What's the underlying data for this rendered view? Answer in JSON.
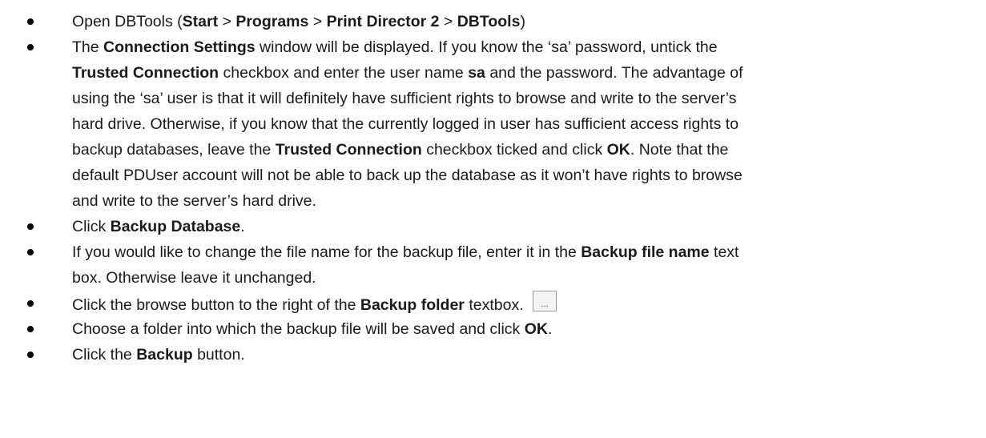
{
  "steps": [
    {
      "lines": [
        [
          {
            "t": "Open DBTools ("
          },
          {
            "t": "Start",
            "b": 1
          },
          {
            "t": " > "
          },
          {
            "t": "Programs",
            "b": 1
          },
          {
            "t": " > "
          },
          {
            "t": "Print Director 2",
            "b": 1
          },
          {
            "t": " > "
          },
          {
            "t": "DBTools",
            "b": 1
          },
          {
            "t": ")"
          }
        ]
      ]
    },
    {
      "lines": [
        [
          {
            "t": "The "
          },
          {
            "t": "Connection Settings",
            "b": 1
          },
          {
            "t": " window will be displayed. If you know the ‘sa’ password, untick the"
          }
        ],
        [
          {
            "t": "Trusted Connection",
            "b": 1
          },
          {
            "t": " checkbox and enter the user name "
          },
          {
            "t": "sa",
            "b": 1
          },
          {
            "t": " and the password. The advantage of"
          }
        ],
        [
          {
            "t": "using the ‘sa’ user is that it will definitely have sufficient rights to browse and write to the server’s"
          }
        ],
        [
          {
            "t": "hard drive. Otherwise, if you know that the currently logged in user has sufficient access rights to"
          }
        ],
        [
          {
            "t": "backup databases, leave the "
          },
          {
            "t": "Trusted Connection",
            "b": 1
          },
          {
            "t": " checkbox ticked and click "
          },
          {
            "t": "OK",
            "b": 1
          },
          {
            "t": ". Note that the"
          }
        ],
        [
          {
            "t": "default PDUser account will not be able to back up the database as it won’t have rights to browse"
          }
        ],
        [
          {
            "t": "and write to the server’s hard drive."
          }
        ]
      ]
    },
    {
      "lines": [
        [
          {
            "t": "Click "
          },
          {
            "t": "Backup Database",
            "b": 1
          },
          {
            "t": "."
          }
        ]
      ]
    },
    {
      "lines": [
        [
          {
            "t": "If you would like to change the file name for the backup file, enter it in the "
          },
          {
            "t": "Backup file name",
            "b": 1
          },
          {
            "t": " text"
          }
        ],
        [
          {
            "t": "box. Otherwise leave it unchanged."
          }
        ]
      ]
    },
    {
      "lines": [
        [
          {
            "t": "Click the browse button to the right of the "
          },
          {
            "t": "Backup folder",
            "b": 1
          },
          {
            "t": " textbox. "
          },
          {
            "btn": "browse"
          }
        ]
      ]
    },
    {
      "lines": [
        [
          {
            "t": "Choose a folder into which the backup file will be saved and click "
          },
          {
            "t": "OK",
            "b": 1
          },
          {
            "t": "."
          }
        ]
      ]
    },
    {
      "lines": [
        [
          {
            "t": "Click the "
          },
          {
            "t": "Backup",
            "b": 1
          },
          {
            "t": " button."
          }
        ]
      ]
    }
  ],
  "browse_button": {
    "label": "..."
  }
}
